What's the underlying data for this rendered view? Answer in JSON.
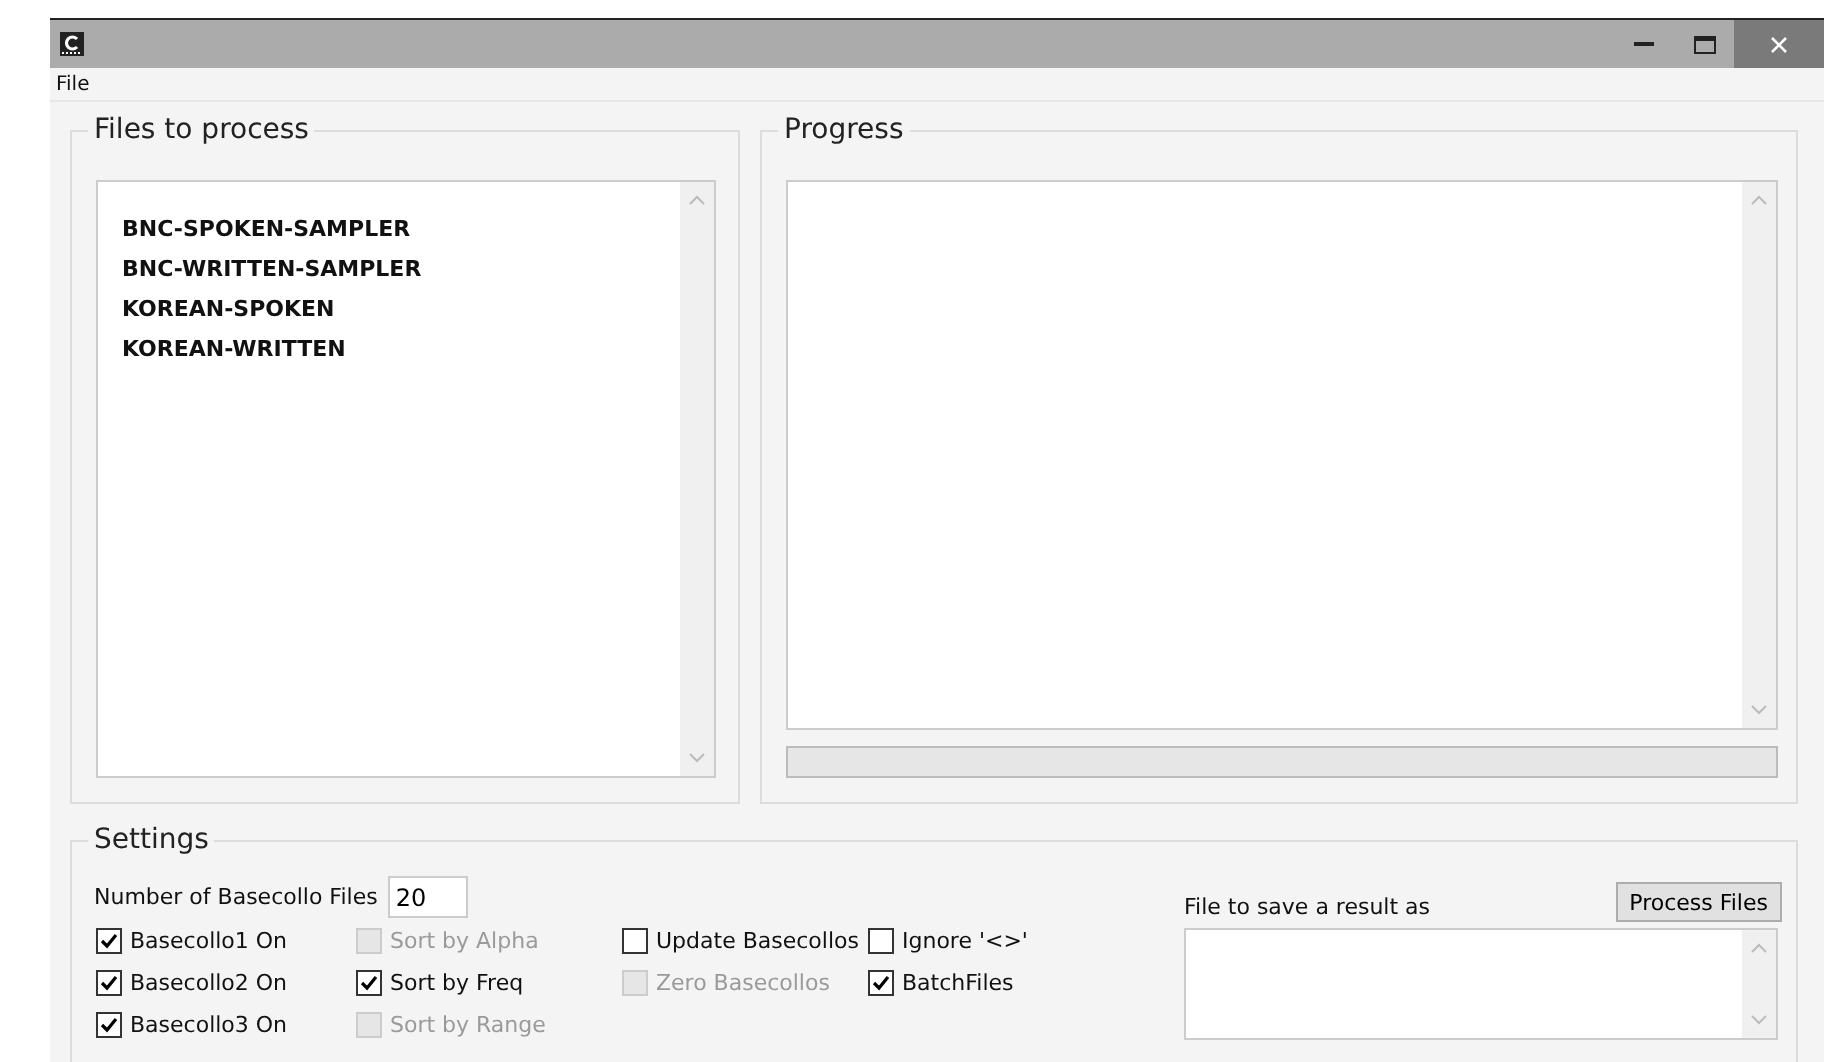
{
  "menu": [
    "File"
  ],
  "files_group": {
    "title": "Files to process",
    "items": [
      {
        "label": "BNC-SPOKEN-SAMPLER"
      },
      {
        "label": "BNC-WRITTEN-SAMPLER"
      },
      {
        "label": "KOREAN-SPOKEN"
      },
      {
        "label": "KOREAN-WRITTEN"
      }
    ]
  },
  "progress_group": {
    "title": "Progress",
    "progress": {
      "level": 0
    }
  },
  "settings": {
    "title": "Settings",
    "basecollo_files": {
      "label": "Number of Basecollo Files",
      "value": "20"
    },
    "checkboxes": [
      {
        "label": "Basecollo1 On",
        "checked": true,
        "disabled": false
      },
      {
        "label": "Sort by Alpha",
        "checked": false,
        "disabled": true
      },
      {
        "label": "Update Basecollos",
        "checked": false,
        "disabled": false
      },
      {
        "label": "Ignore '<>'",
        "checked": false,
        "disabled": false
      },
      {
        "label": "Basecollo2 On",
        "checked": true,
        "disabled": false
      },
      {
        "label": "Sort by Freq",
        "checked": true,
        "disabled": false
      },
      {
        "label": "Zero Basecollos",
        "checked": false,
        "disabled": true
      },
      {
        "label": "BatchFiles",
        "checked": true,
        "disabled": false
      },
      {
        "label": "Basecollo3 On",
        "checked": true,
        "disabled": false
      },
      {
        "label": "Sort by Range",
        "checked": false,
        "disabled": true
      }
    ],
    "save": {
      "label": "File to save a result as",
      "button": "Process Files"
    }
  }
}
